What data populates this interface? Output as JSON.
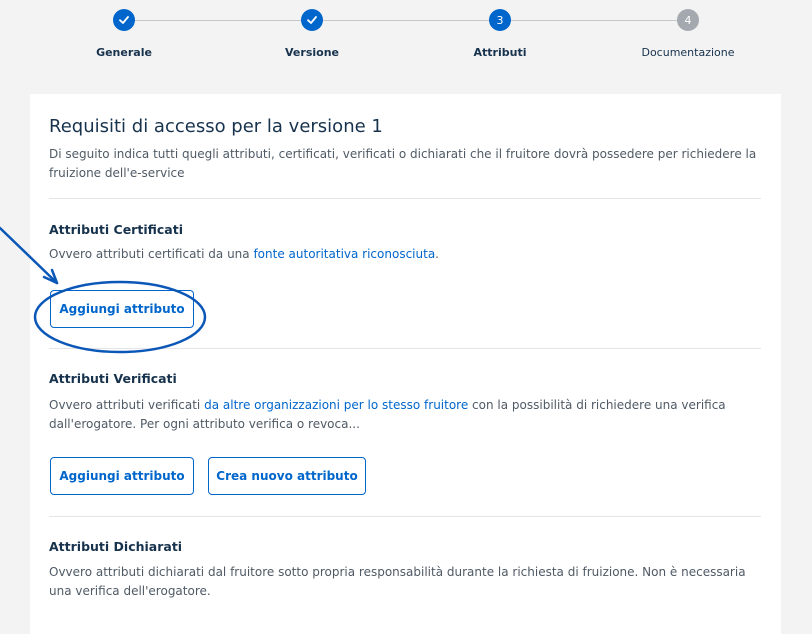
{
  "stepper": {
    "steps": [
      {
        "label": "Generale",
        "status": "done",
        "icon": "check-icon"
      },
      {
        "label": "Versione",
        "status": "done",
        "icon": "check-icon"
      },
      {
        "label": "Attributi",
        "status": "active",
        "number": "3"
      },
      {
        "label": "Documentazione",
        "status": "todo",
        "number": "4"
      }
    ]
  },
  "card": {
    "title": "Requisiti di accesso per la versione 1",
    "subtitle": "Di seguito indica tutti quegli attributi, certificati, verificati o dichiarati che il fruitore dovrà possedere per richiedere la fruizione dell'e-service"
  },
  "certified": {
    "title": "Attributi Certificati",
    "desc_before": "Ovvero attributi certificati da una ",
    "desc_link": "fonte autoritativa riconosciuta",
    "desc_after": ".",
    "add_button": "Aggiungi attributo"
  },
  "verified": {
    "title": "Attributi Verificati",
    "desc_before": "Ovvero attributi verificati ",
    "desc_link": "da altre organizzazioni per lo stesso fruitore",
    "desc_after": " con la possibilità di richiedere una verifica dall'erogatore. Per ogni attributo verifica o revoca...",
    "add_button": "Aggiungi attributo",
    "create_button": "Crea nuovo attributo"
  },
  "declared": {
    "title": "Attributi Dichiarati",
    "desc": "Ovvero attributi dichiarati dal fruitore sotto propria responsabilità durante la richiesta di fruizione. Non è necessaria una verifica dell'erogatore."
  },
  "colors": {
    "accent": "#0066cc",
    "annotation": "#0b57b8",
    "inactive_step": "#a3a9af",
    "background": "#f3f3f3"
  }
}
